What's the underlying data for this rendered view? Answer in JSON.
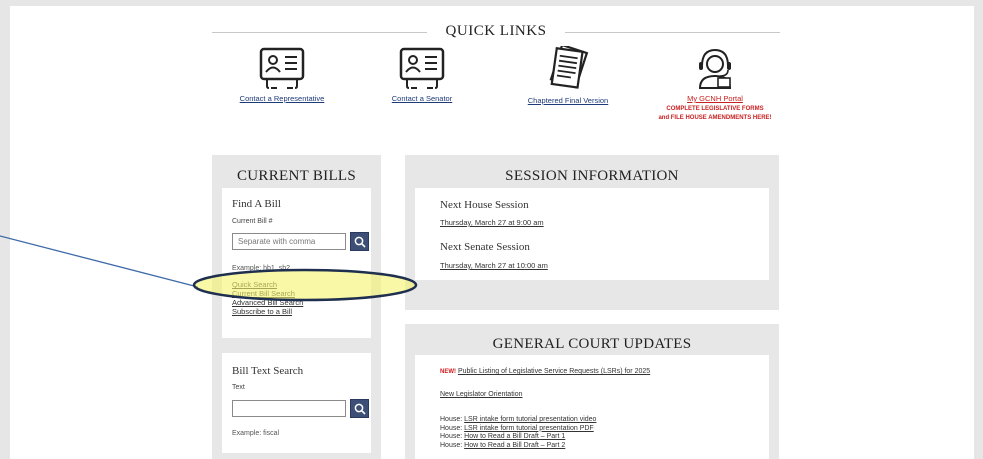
{
  "quick_links": {
    "title": "QUICK LINKS",
    "items": [
      {
        "label": "Contact a Representative",
        "icon": "contact-card-icon"
      },
      {
        "label": "Contact a Senator",
        "icon": "contact-card-icon"
      },
      {
        "label": "Chaptered Final Version",
        "icon": "document-stack-icon"
      },
      {
        "label": "My GCNH Portal",
        "icon": "headset-agent-icon",
        "note_1": "COMPLETE LEGISLATIVE FORMS",
        "note_2": "and FILE HOUSE AMENDMENTS HERE!"
      }
    ]
  },
  "current_bills": {
    "title": "CURRENT BILLS",
    "find_heading": "Find A Bill",
    "field_label": "Current Bill #",
    "placeholder": "Separate with comma",
    "example": "Example: hb1, sb2",
    "links": [
      "Quick Search",
      "Current Bill Search",
      "Advanced Bill Search",
      "Subscribe to a Bill"
    ]
  },
  "bill_text_search": {
    "heading": "Bill Text Search",
    "field_label": "Text",
    "example": "Example: fiscal"
  },
  "session_info": {
    "title": "SESSION INFORMATION",
    "house_heading": "Next House Session",
    "house_date": "Thursday, March 27 at 9:00 am",
    "senate_heading": "Next Senate Session",
    "senate_date": "Thursday, March 27 at 10:00 am"
  },
  "updates": {
    "title": "GENERAL COURT UPDATES",
    "new_badge": "NEW!",
    "item1": "Public Listing of Legislative Service Requests (LSRs) for 2025",
    "item2": "New Legislator Orientation",
    "prefix": "House:",
    "item3": "LSR intake form tutorial presentation video",
    "item4": "LSR intake form tutorial presentation PDF",
    "item5": "How to Read a Bill Draft – Part 1",
    "item6": "How to Read a Bill Draft – Part 2"
  },
  "colors": {
    "accent": "#3d4f77",
    "link_blue": "#1e3a78",
    "alert_red": "#c82020",
    "highlight": "#f4f46a",
    "annotation_line": "#3f6aa8"
  }
}
